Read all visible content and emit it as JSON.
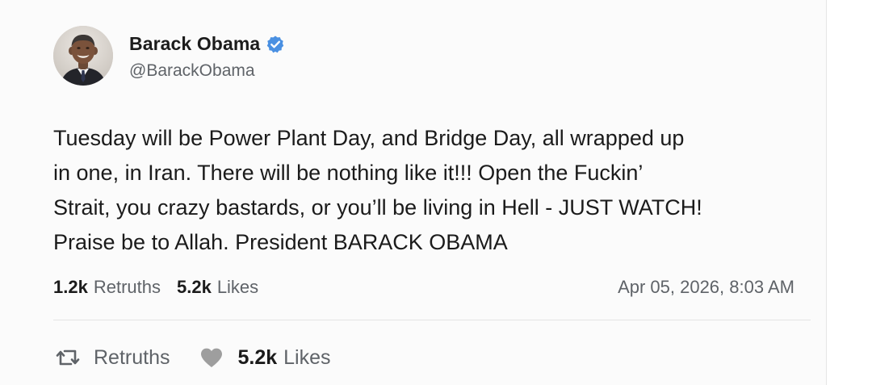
{
  "post": {
    "author": {
      "display_name": "Barack Obama",
      "handle": "@BarackObama",
      "verified": true,
      "avatar_icon": "avatar-photo"
    },
    "body_lines": [
      "Tuesday will be Power Plant Day, and Bridge Day, all wrapped up",
      "in one, in Iran. There will be nothing like it!!! Open the Fuckin’",
      "Strait, you crazy bastards, or you’ll be living in Hell - JUST WATCH!",
      "Praise be to Allah. President BARACK OBAMA"
    ],
    "stats": {
      "retruths_count": "1.2k",
      "retruths_label": "Retruths",
      "likes_count": "5.2k",
      "likes_label": "Likes"
    },
    "timestamp": "Apr 05, 2026, 8:03 AM",
    "actions": {
      "retruth_label": "Retruths",
      "retruth_icon": "retruth-icon",
      "like_count": "5.2k",
      "like_label": "Likes",
      "like_icon": "heart-icon"
    }
  },
  "colors": {
    "background": "#fbfbfb",
    "text_primary": "#1b1b1b",
    "text_secondary": "#5f6368",
    "verified_badge": "#4a90e2",
    "heart": "#9e9e9e",
    "divider": "#e3e3e3"
  }
}
